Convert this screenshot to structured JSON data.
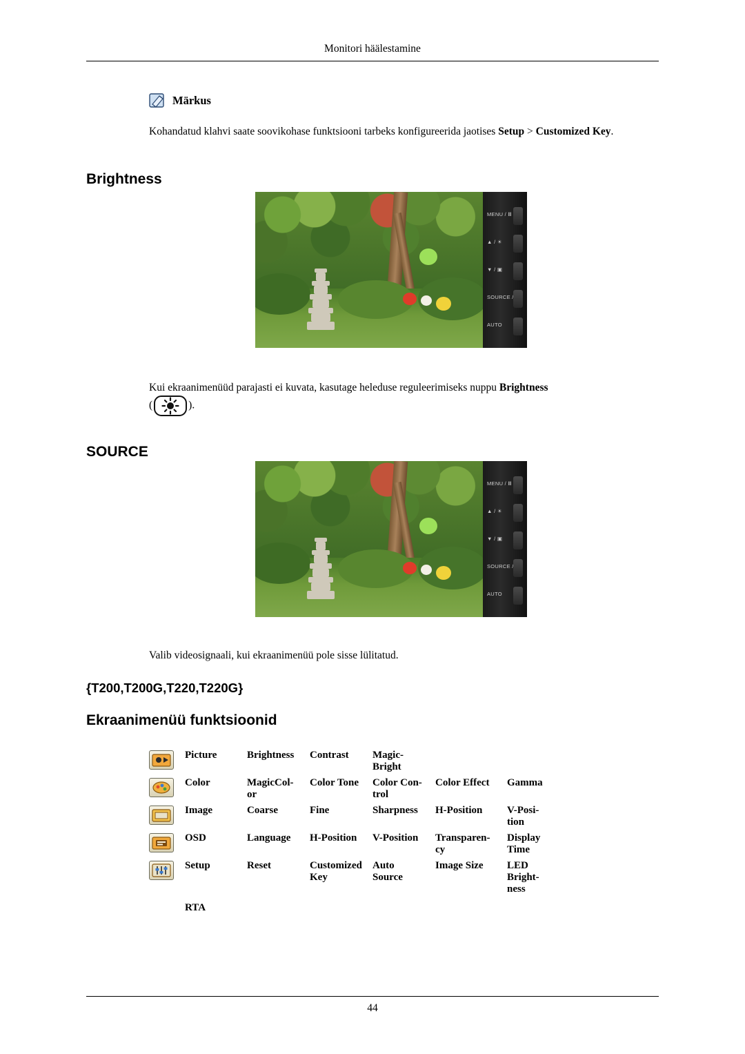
{
  "page": {
    "header": "Monitori häälestamine",
    "footer_page_number": "44"
  },
  "note": {
    "title": "Märkus",
    "icon": "note-pencil-icon",
    "text_part1": "Kohandatud klahvi saate soovikohase funktsiooni tarbeks konfigureerida jaotises ",
    "text_bold1": "Setup",
    "text_part2": " > ",
    "text_bold2": "Customized Key",
    "text_part3": "."
  },
  "sections": {
    "brightness_heading": "Brightness",
    "brightness_text_1": "Kui ekraanimenüüd parajasti ei kuvata, kasutage heleduse reguleerimiseks nuppu ",
    "brightness_text_bold": "Brightness",
    "brightness_text_2": " (",
    "brightness_text_3": ").",
    "source_heading": "SOURCE",
    "source_text": "Valib videosignaali, kui ekraanimenüü pole sisse lülitatud.",
    "models_heading": "{T200,T200G,T220,T220G}",
    "osd_heading": "Ekraanimenüü funktsioonid"
  },
  "monitor": {
    "buttons": [
      "MENU / Ⅲ",
      "▲ / ☀",
      "▼ / ▣",
      "SOURCE / ⏎",
      "AUTO"
    ]
  },
  "osd_table": {
    "rows": [
      {
        "icon": "picture-icon",
        "category": "Picture",
        "items": [
          "Brightness",
          "Contrast",
          "Magic-\nBright"
        ]
      },
      {
        "icon": "color-icon",
        "category": "Color",
        "items": [
          "MagicCol-\nor",
          "Color Tone",
          "Color  Con-\ntrol",
          "Color Effect",
          "Gamma"
        ]
      },
      {
        "icon": "image-icon",
        "category": "Image",
        "items": [
          "Coarse",
          "Fine",
          "Sharpness",
          "H-Position",
          "V-Posi-\ntion"
        ]
      },
      {
        "icon": "osd-icon",
        "category": "OSD",
        "items": [
          "Language",
          "H-Position",
          "V-Position",
          "Transparen-\ncy",
          "Display\nTime"
        ]
      },
      {
        "icon": "setup-icon",
        "category": "Setup",
        "items": [
          "Reset",
          "Customized\nKey",
          "Auto\nSource",
          "Image Size",
          "LED\nBright-\nness"
        ]
      }
    ],
    "rta_label": "RTA"
  },
  "colors": {
    "text": "#000000",
    "rule": "#000000",
    "bezel_dark": "#111111",
    "icon_border": "#6b6b5a"
  }
}
